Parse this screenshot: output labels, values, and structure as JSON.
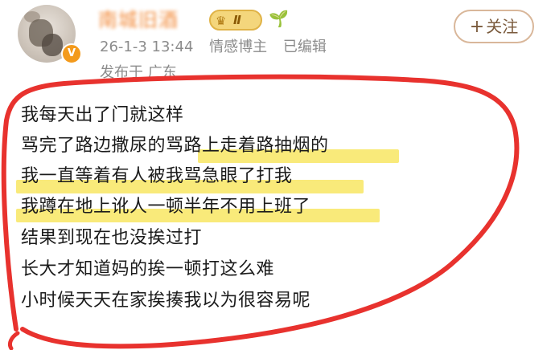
{
  "post": {
    "username": "南城旧酒",
    "level": "Ⅱ",
    "verified_mark": "V",
    "date": "26-1-3 13:44",
    "tag": "情感博主",
    "edited": "已编辑",
    "source": "发布于 广东",
    "follow_label": "关注",
    "follow_plus": "+",
    "lines": [
      "我每天出了门就这样",
      "骂完了路边撒尿的骂路上走着路抽烟的",
      "我一直等着有人被我骂急眼了打我",
      "我蹲在地上讹人一顿半年不用上班了",
      "结果到现在也没挨过打",
      "长大才知道妈的挨一顿打这么难",
      "小时候天天在家挨揍我以为很容易呢"
    ]
  },
  "colors": {
    "username": "#f07a1e",
    "highlight": "#f9ea7a",
    "annotation": "#e8322e",
    "meta": "#8c8c8c"
  },
  "icons": [
    "crown-icon",
    "sprout-icon",
    "plus-icon",
    "verified-icon"
  ]
}
